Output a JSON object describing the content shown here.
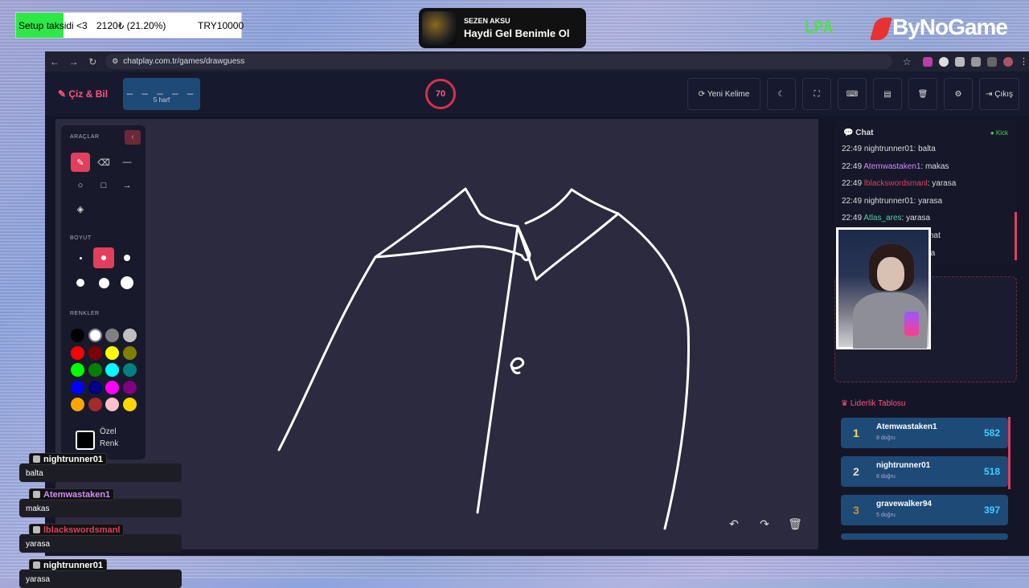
{
  "overlay": {
    "goal_label": "Setup taksidi <3",
    "goal_amount": "2120₺ (21.20%)",
    "goal_target": "TRY10000",
    "goal_progress": 0.212,
    "music_artist": "SEZEN AKSU",
    "music_song": "Haydi Gel Benimle Ol",
    "lpa_logo": "LPA",
    "brand": "ByNoGame"
  },
  "browser": {
    "url": "chatplay.com.tr/games/drawguess"
  },
  "app": {
    "logo": "Çiz & Bil",
    "word_mask": "_ _ _ _ _",
    "word_length": "5 harf",
    "timer": "70",
    "buttons": [
      "Yeni Kelime",
      "",
      "",
      "",
      "",
      "",
      "",
      "Çıkış"
    ]
  },
  "tools": {
    "tools_title": "ARAÇLAR",
    "size_title": "BOYUT",
    "colors_title": "RENKLER",
    "custom_label_1": "Özel",
    "custom_label_2": "Renk",
    "colors": [
      "#000000",
      "#ffffff",
      "#808080",
      "#c0c0c0",
      "#ff0000",
      "#800000",
      "#ffff00",
      "#808000",
      "#00ff00",
      "#008000",
      "#00ffff",
      "#008080",
      "#0000ff",
      "#000080",
      "#ff00ff",
      "#800080",
      "#ffa500",
      "#a52a2a",
      "#ffc0cb",
      "#ffd700"
    ]
  },
  "chat": {
    "title": "Chat",
    "platform": "Kick",
    "messages": [
      {
        "time": "22:49",
        "user": "nightrunner01",
        "user_color": "#dddddd",
        "text": ": balta"
      },
      {
        "time": "22:49",
        "user": "Atemwastaken1",
        "user_color": "#d08cff",
        "text": ": makas"
      },
      {
        "time": "22:49",
        "user": "lblackswordsmanl",
        "user_color": "#e23e5d",
        "text": ": yarasa"
      },
      {
        "time": "22:49",
        "user": "nightrunner01",
        "user_color": "#dddddd",
        "text": ": yarasa"
      },
      {
        "time": "22:49",
        "user": "Atlas_ares",
        "user_color": "#4fd0a0",
        "text": ": yarasa"
      },
      {
        "time": "22:49",
        "user": "gravewalker94",
        "user_color": "#dddddd",
        "text": ": kanat"
      },
      {
        "time": "22:49",
        "user": "nightrunner01",
        "user_color": "#dddddd",
        "text": ": yaka"
      }
    ]
  },
  "leaderboard": {
    "title": "Liderlik Tablosu",
    "rows": [
      {
        "rank": "1",
        "name": "Atemwastaken1",
        "sub": "8 doğru",
        "score": "582",
        "rank_color": "#ffd84a"
      },
      {
        "rank": "2",
        "name": "nightrunner01",
        "sub": "8 doğru",
        "score": "518",
        "rank_color": "#dddddd"
      },
      {
        "rank": "3",
        "name": "gravewalker94",
        "sub": "5 doğru",
        "score": "397",
        "rank_color": "#d08a3a"
      }
    ]
  },
  "stream_chat": [
    {
      "user": "nightrunner01",
      "user_color": "#ffffff",
      "text": "balta"
    },
    {
      "user": "Atemwastaken1",
      "user_color": "#d08cff",
      "text": "makas"
    },
    {
      "user": "lblackswordsmanl",
      "user_color": "#e23e5d",
      "text": "yarasa"
    },
    {
      "user": "nightrunner01",
      "user_color": "#ffffff",
      "text": "yarasa"
    }
  ]
}
